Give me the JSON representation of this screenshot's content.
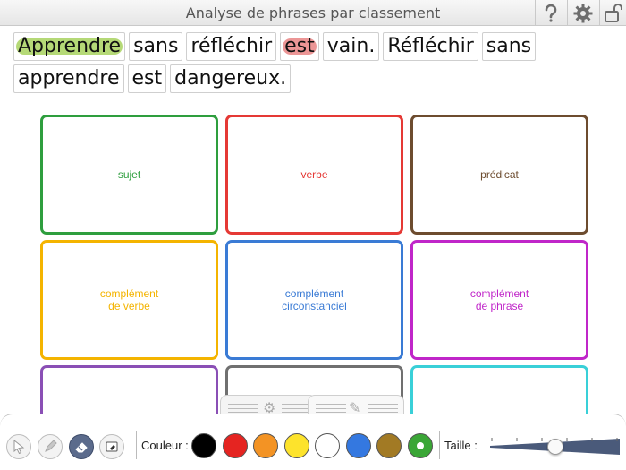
{
  "header": {
    "title": "Analyse de phrases par classement",
    "help_icon": "question-mark-icon",
    "settings_icon": "gear-icon",
    "lock_icon": "unlock-icon"
  },
  "sentence": {
    "words": [
      {
        "text": "Apprendre",
        "highlight": "#9ccc4a"
      },
      {
        "text": "sans",
        "highlight": ""
      },
      {
        "text": "réfléchir",
        "highlight": ""
      },
      {
        "text": "est",
        "highlight": "#e57373"
      },
      {
        "text": "vain.",
        "highlight": ""
      },
      {
        "text": "Réfléchir",
        "highlight": ""
      },
      {
        "text": "sans",
        "highlight": ""
      },
      {
        "text": "apprendre",
        "highlight": ""
      },
      {
        "text": "est",
        "highlight": ""
      },
      {
        "text": "dangereux.",
        "highlight": ""
      }
    ]
  },
  "categories": [
    {
      "label": "sujet",
      "color": "#2e9e3e"
    },
    {
      "label": "verbe",
      "color": "#e53935"
    },
    {
      "label": "prédicat",
      "color": "#6d4c2f"
    },
    {
      "label": "complément\nde verbe",
      "color": "#f4b400"
    },
    {
      "label": "complément\ncirconstanciel",
      "color": "#3a7bd5"
    },
    {
      "label": "complément\nde phrase",
      "color": "#c026c9"
    },
    {
      "label": "",
      "color": "#8a4fb5"
    },
    {
      "label": "",
      "color": "#707070"
    },
    {
      "label": "",
      "color": "#39d0d8"
    }
  ],
  "toolbar": {
    "tools": [
      "pointer-icon",
      "highlighter-icon",
      "eraser-icon",
      "clear-icon"
    ],
    "couleur_label": "Couleur :",
    "colors": [
      "#000000",
      "#e52421",
      "#f39324",
      "#fde32c",
      "#ffffff",
      "#3478e0",
      "#a27a24",
      "#3aa636"
    ],
    "selected_color": "#3aa636",
    "taille_label": "Taille :",
    "size_level": 0.5
  },
  "panel_tabs": [
    "settings-tab",
    "edit-tab"
  ]
}
